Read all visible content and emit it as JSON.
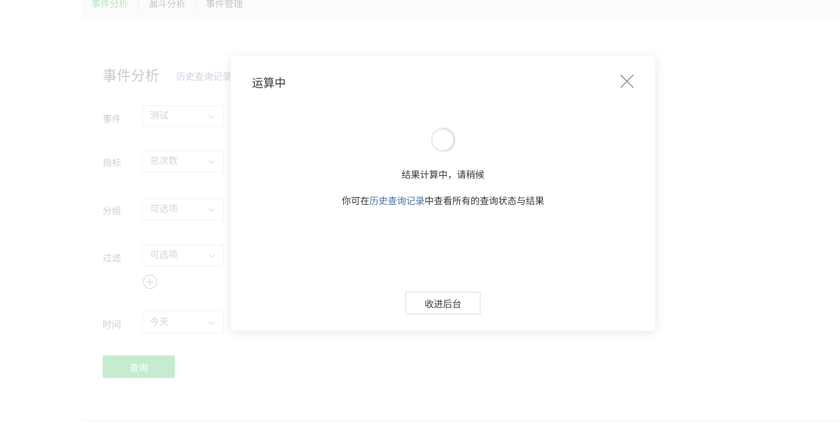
{
  "topnav": {
    "tabs": [
      {
        "label": "事件分析",
        "active": true
      },
      {
        "label": "漏斗分析",
        "active": false
      },
      {
        "label": "事件管理",
        "active": false
      }
    ]
  },
  "panel": {
    "title": "事件分析",
    "history_link": "历史查询记录",
    "fields": [
      {
        "label": "事件",
        "value": "测试"
      },
      {
        "label": "指标",
        "value": "总次数"
      },
      {
        "label": "分组",
        "value": "可选项"
      },
      {
        "label": "过滤",
        "value": "可选项"
      },
      {
        "label": "时间",
        "value": "今天"
      }
    ],
    "query_label": "查询"
  },
  "modal": {
    "title": "运算中",
    "message": "结果计算中，请稍候",
    "hint_prefix": "你可在",
    "hint_link": "历史查询记录",
    "hint_suffix": "中查看所有的查询状态与结果",
    "background_button": "收进后台"
  },
  "icons": {
    "close": "close-icon",
    "spinner": "loading-spinner-icon",
    "chevron": "chevron-down-icon",
    "add": "plus-circle-icon"
  },
  "colors": {
    "accent_green": "#b3e6c1",
    "active_tab": "#9fdcb0",
    "link": "#3d6ea3"
  }
}
